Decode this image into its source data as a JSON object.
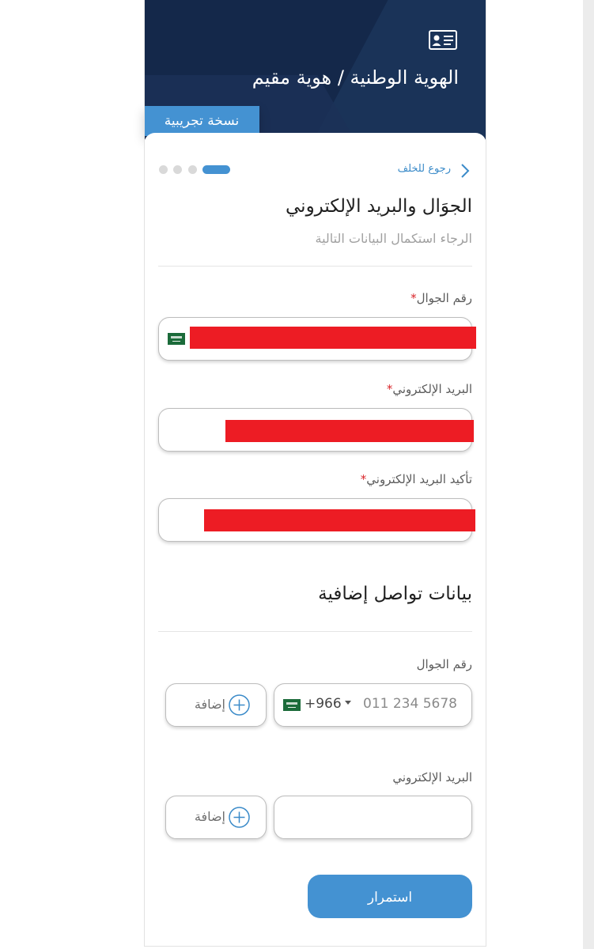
{
  "header": {
    "title": "الهوية الوطنية / هوية مقيم",
    "badge": "نسخة تجريبية",
    "icon": "id-card-icon"
  },
  "nav": {
    "back_label": "رجوع للخلف",
    "steps_total": 4,
    "current_step": 1
  },
  "main": {
    "title": "الجوَال والبريد الإلكتروني",
    "subtitle": "الرجاء استكمال البيانات التالية",
    "fields": [
      {
        "label": "رقم الجوال",
        "required_mark": "*",
        "value_redacted": true
      },
      {
        "label": "البريد الإلكتروني",
        "required_mark": "*",
        "value_redacted": true
      },
      {
        "label": "تأكيد البريد الإلكتروني",
        "required_mark": "*",
        "value_redacted": true
      }
    ]
  },
  "extra": {
    "title": "بيانات تواصل إضافية",
    "phone_label": "رقم الجوال",
    "country_code": "+966",
    "phone_placeholder": "011 234 5678",
    "email_label": "البريد الإلكتروني",
    "email_placeholder": "",
    "add_label": "إضافة"
  },
  "actions": {
    "continue_label": "استمرار"
  },
  "colors": {
    "header_bg": "#14284a",
    "accent": "#4492d2",
    "required": "#d9252a",
    "redaction": "#ed1c24"
  }
}
